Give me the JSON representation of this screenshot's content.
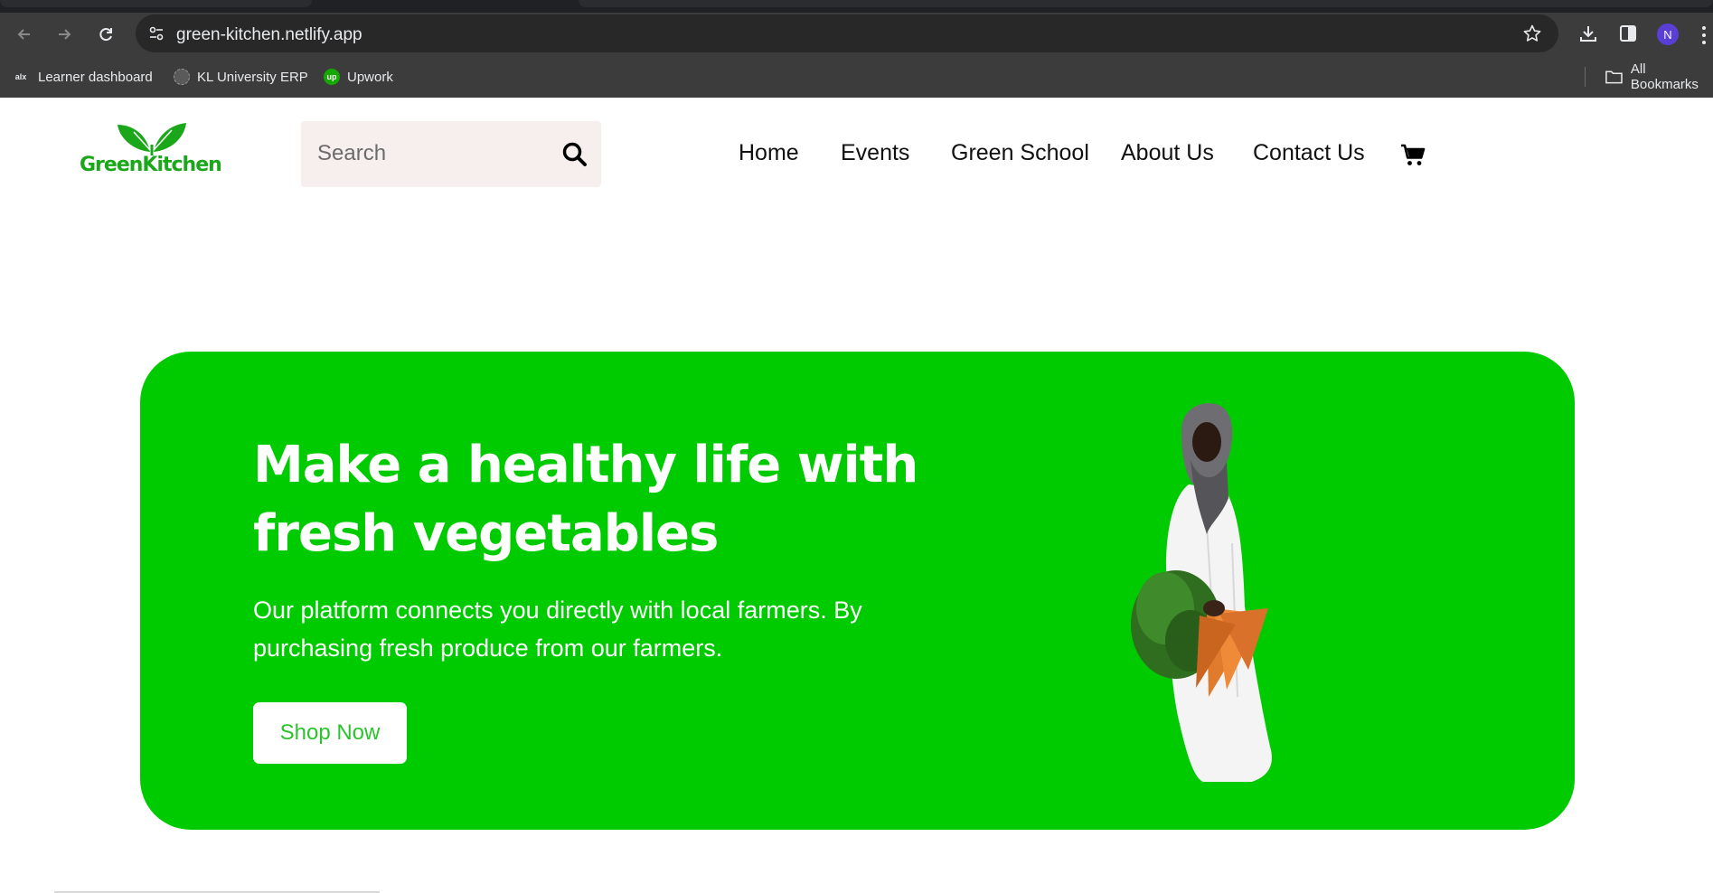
{
  "browser": {
    "url": "green-kitchen.netlify.app",
    "profile_initial": "N",
    "bookmarks": [
      {
        "label": "Learner dashboard",
        "icon": "alx-icon"
      },
      {
        "label": "KL University ERP",
        "icon": "kl-university-icon"
      },
      {
        "label": "Upwork",
        "icon": "upwork-icon"
      }
    ],
    "all_bookmarks": "All Bookmarks",
    "upwork_favicon_text": "up",
    "alx_favicon_text": "alx"
  },
  "header": {
    "logo_text": "GreenKitchen",
    "search_placeholder": "Search",
    "nav": [
      "Home",
      "Events",
      "Green School",
      "About Us",
      "Contact Us"
    ]
  },
  "hero": {
    "title_line1": "Make a healthy life with",
    "title_line2": "fresh vegetables",
    "text_line1": "Our platform connects you directly with local farmers. By",
    "text_line2": "purchasing fresh produce from our farmers.",
    "button": "Shop Now"
  },
  "colors": {
    "brand_green": "#00cb00",
    "logo_green": "#1aa81a",
    "button_text": "#2cc32c",
    "search_bg": "#f7efee"
  }
}
